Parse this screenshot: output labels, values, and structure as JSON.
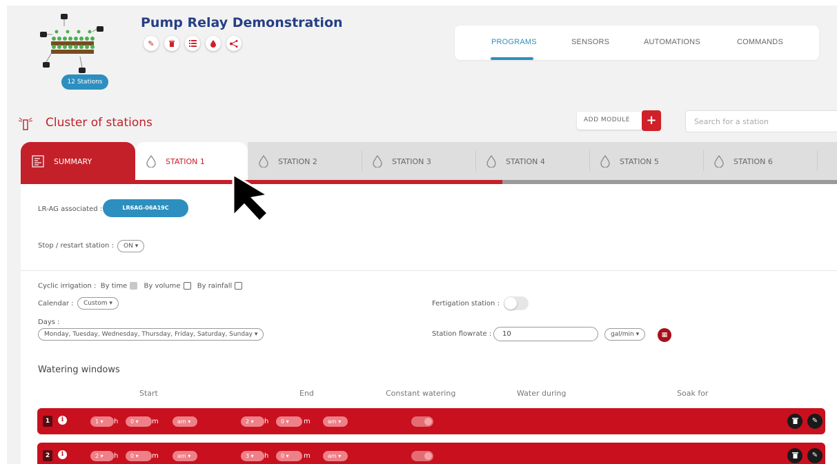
{
  "header": {
    "title": "Pump Relay Demonstration",
    "stations_badge": "12 Stations",
    "action_icons": [
      "pencil-icon",
      "trash-icon",
      "list-icon",
      "water-drop-icon",
      "share-icon"
    ]
  },
  "nav": {
    "tabs": [
      "PROGRAMS",
      "SENSORS",
      "AUTOMATIONS",
      "COMMANDS"
    ],
    "active": "PROGRAMS"
  },
  "section": {
    "title": "Cluster of stations",
    "add_module": "ADD MODULE",
    "search_placeholder": "Search for a station"
  },
  "station_tabs": {
    "summary": "SUMMARY",
    "stations": [
      "STATION 1",
      "STATION 2",
      "STATION 3",
      "STATION 4",
      "STATION 5",
      "STATION 6"
    ],
    "active": "STATION 1",
    "progress_fraction": 0.59
  },
  "station": {
    "lr_label": "LR-AG associated :",
    "lr_value": "LR6AG-06A19C",
    "stop_label": "Stop / restart station :",
    "stop_value": "ON",
    "cyclic_label": "Cyclic irrigation :",
    "by_time": "By time",
    "by_volume": "By volume",
    "by_rainfall": "By rainfall",
    "calendar_label": "Calendar :",
    "calendar_value": "Custom",
    "days_label": "Days :",
    "days_value": "Monday, Tuesday, Wednesday, Thursday, Friday, Saturday, Sunday",
    "fertigation_label": "Fertigation station :",
    "flowrate_label": "Station flowrate :",
    "flowrate_value": "10",
    "flowrate_unit": "gal/min"
  },
  "watering": {
    "title": "Watering windows",
    "columns": [
      "Start",
      "End",
      "Constant watering",
      "Water during",
      "Soak for"
    ],
    "rows": [
      {
        "num": "1",
        "start_h": "1",
        "start_m": "0",
        "start_ampm": "am",
        "end_h": "2",
        "end_m": "0",
        "end_ampm": "am"
      },
      {
        "num": "2",
        "start_h": "2",
        "start_m": "0",
        "start_ampm": "am",
        "end_h": "3",
        "end_m": "0",
        "end_ampm": "am"
      }
    ],
    "hour_unit": "h",
    "minute_unit": "m"
  },
  "colors": {
    "accent_red": "#c4202a",
    "accent_blue": "#2d8fbf",
    "title_navy": "#263f85"
  }
}
